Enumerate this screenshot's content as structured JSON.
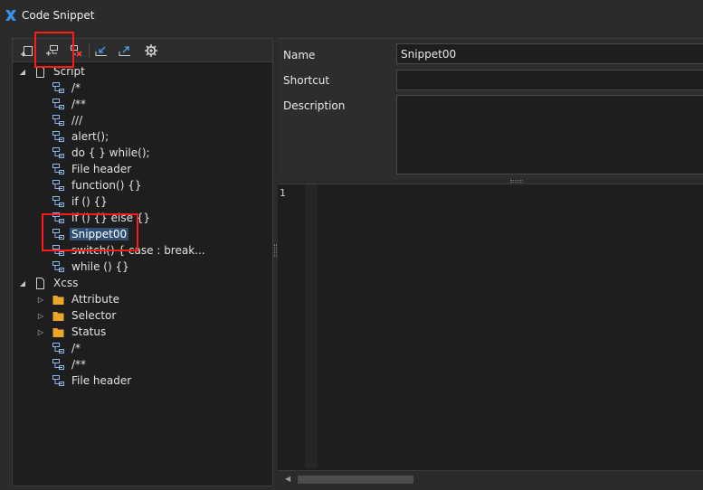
{
  "window": {
    "title": "Code Snippet"
  },
  "toolbar": {
    "buttons": [
      {
        "name": "add-group-icon"
      },
      {
        "name": "add-snippet-icon"
      },
      {
        "name": "delete-icon"
      },
      {
        "name": "import-icon"
      },
      {
        "name": "export-icon"
      },
      {
        "name": "settings-icon"
      }
    ]
  },
  "tree": {
    "script": {
      "label": "Script",
      "children": [
        "/*",
        "/**",
        "///",
        "alert();",
        "do { } while();",
        "File header",
        "function() {}",
        "if () {}",
        "if () {} else {}",
        "Snippet00",
        "switch() { case : break...",
        "while () {}"
      ]
    },
    "xcss": {
      "label": "Xcss",
      "folders": [
        "Attribute",
        "Selector",
        "Status"
      ],
      "children": [
        "/*",
        "/**",
        "File header"
      ]
    },
    "selected": "Snippet00"
  },
  "properties": {
    "name_label": "Name",
    "name_value": "Snippet00",
    "shortcut_label": "Shortcut",
    "shortcut_value": "",
    "description_label": "Description",
    "description_value": ""
  },
  "editor": {
    "line_numbers": [
      "1"
    ]
  },
  "colors": {
    "background": "#2b2b2b",
    "panel": "#1e1e1e",
    "selection": "#2f4f74",
    "highlight": "#ff1a1a",
    "app_icon": "#3a8ee6",
    "folder": "#e8a92a"
  }
}
